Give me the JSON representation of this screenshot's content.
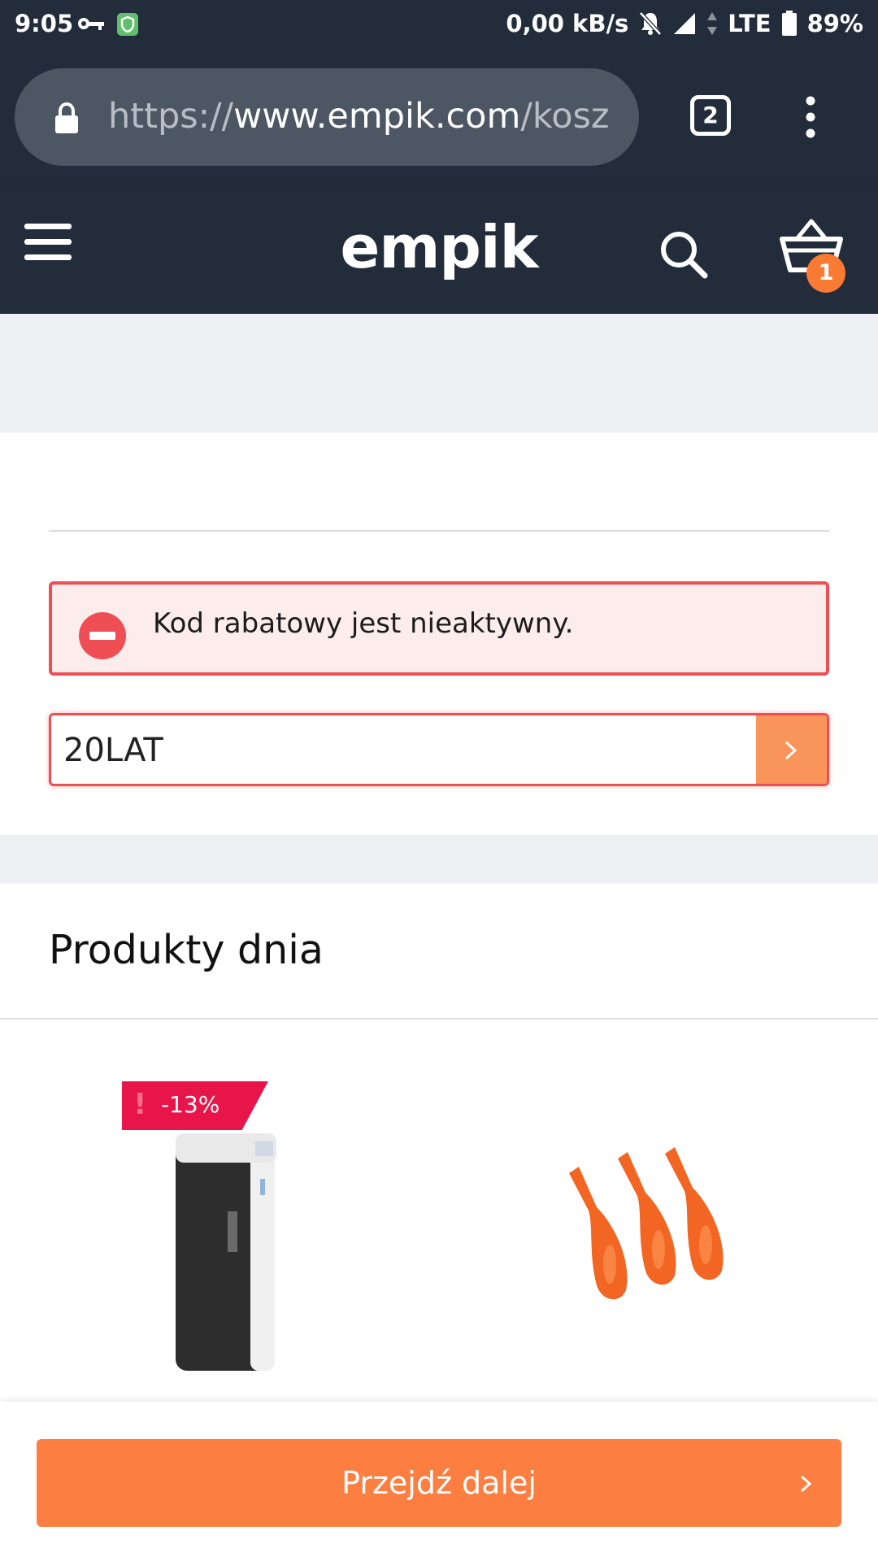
{
  "status_bar": {
    "time": "9:05",
    "net_speed": "0,00 kB/s",
    "network": "LTE",
    "battery": "89%",
    "icons": [
      "key-icon",
      "shield-icon",
      "bell-muted-icon",
      "signal-icon",
      "battery-icon"
    ]
  },
  "browser": {
    "url_scheme": "https://",
    "url_host": "www.empik.com",
    "url_path": "/kosz",
    "tab_count": "2"
  },
  "header": {
    "logo": "empik",
    "cart_count": "1"
  },
  "coupon": {
    "error_message": "Kod rabatowy jest nieaktywny.",
    "value": "20LAT"
  },
  "products_section": {
    "title": "Produkty dnia",
    "items": [
      {
        "badge": "-13%",
        "image": "powerbank"
      },
      {
        "image": "orange-spoons"
      }
    ]
  },
  "cta": {
    "label": "Przejdź dalej"
  },
  "colors": {
    "header_bg": "#222c3a",
    "accent_orange": "#fc7e40",
    "error_red": "#ee4e54",
    "discount_red": "#e8154b"
  }
}
